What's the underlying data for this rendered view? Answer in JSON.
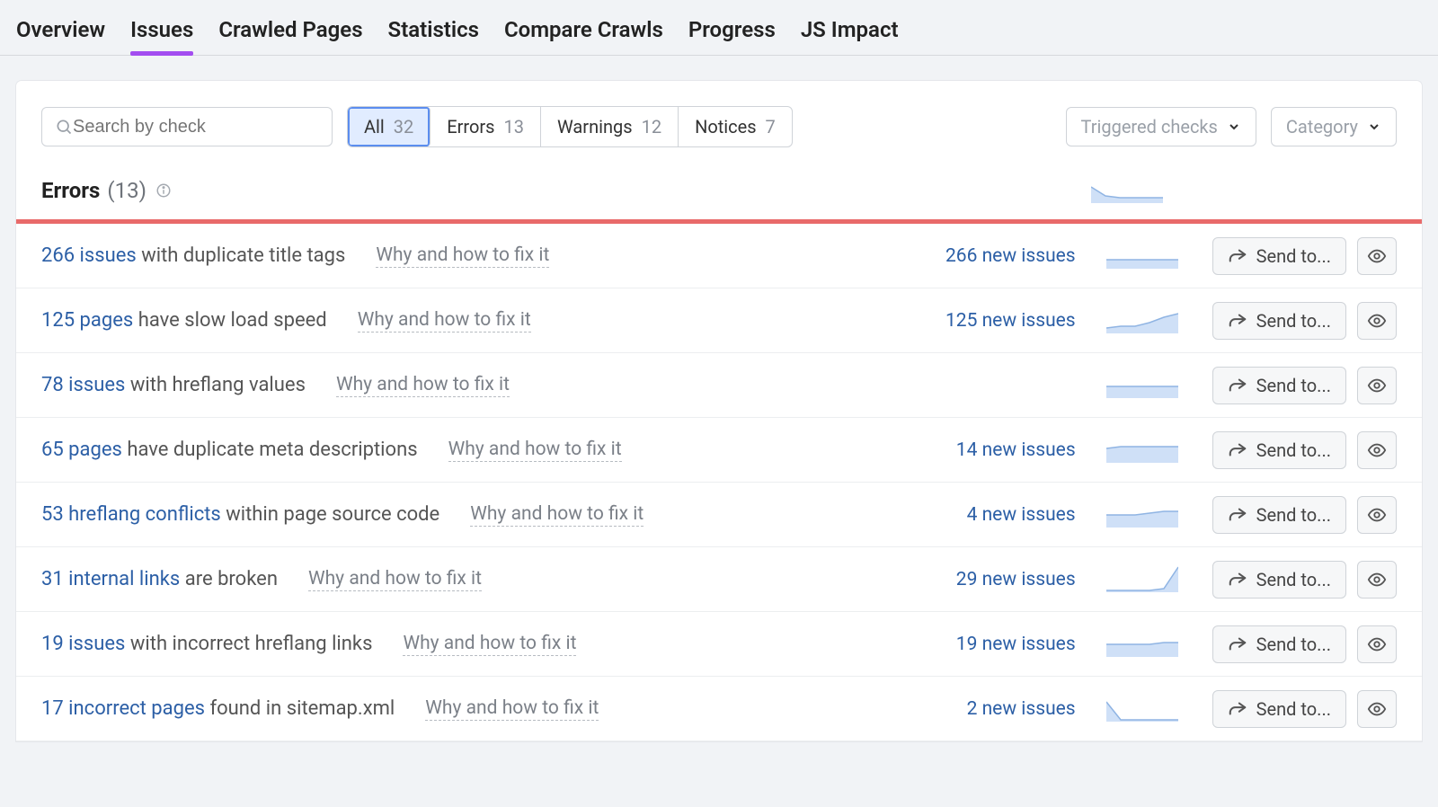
{
  "tabs": [
    "Overview",
    "Issues",
    "Crawled Pages",
    "Statistics",
    "Compare Crawls",
    "Progress",
    "JS Impact"
  ],
  "active_tab": 1,
  "search": {
    "placeholder": "Search by check"
  },
  "segments": [
    {
      "label": "All",
      "count": 32,
      "active": true
    },
    {
      "label": "Errors",
      "count": 13,
      "active": false
    },
    {
      "label": "Warnings",
      "count": 12,
      "active": false
    },
    {
      "label": "Notices",
      "count": 7,
      "active": false
    }
  ],
  "dropdowns": [
    {
      "label": "Triggered checks"
    },
    {
      "label": "Category"
    }
  ],
  "section": {
    "title": "Errors",
    "count": "(13)"
  },
  "fix_label": "Why and how to fix it",
  "send_label": "Send to...",
  "issues": [
    {
      "count": "266 issues",
      "suffix": " with duplicate title tags",
      "new": "266 new issues",
      "spark": [
        22,
        22,
        22,
        22,
        22,
        22
      ]
    },
    {
      "count": "125 pages",
      "suffix": " have slow load speed",
      "new": "125 new issues",
      "spark": [
        26,
        24,
        24,
        20,
        14,
        10
      ]
    },
    {
      "count": "78 issues",
      "suffix": " with hreflang values",
      "new": "",
      "spark": [
        19,
        19,
        19,
        19,
        19,
        19
      ]
    },
    {
      "count": "65 pages",
      "suffix": " have duplicate meta descriptions",
      "new": "14 new issues",
      "spark": [
        16,
        14,
        14,
        14,
        14,
        14
      ]
    },
    {
      "count": "53 hreflang conflicts",
      "suffix": " within page source code",
      "new": "4 new issues",
      "spark": [
        18,
        18,
        18,
        16,
        14,
        14
      ]
    },
    {
      "count": "31 internal links",
      "suffix": " are broken",
      "new": "29 new issues",
      "spark": [
        30,
        30,
        30,
        30,
        28,
        4
      ]
    },
    {
      "count": "19 issues",
      "suffix": " with incorrect hreflang links",
      "new": "19 new issues",
      "spark": [
        18,
        18,
        18,
        18,
        16,
        16
      ]
    },
    {
      "count": "17 incorrect pages",
      "suffix": " found in sitemap.xml",
      "new": "2 new issues",
      "spark": [
        10,
        30,
        30,
        30,
        30,
        30
      ]
    }
  ],
  "head_spark": [
    10,
    20,
    22,
    22,
    22,
    22
  ]
}
